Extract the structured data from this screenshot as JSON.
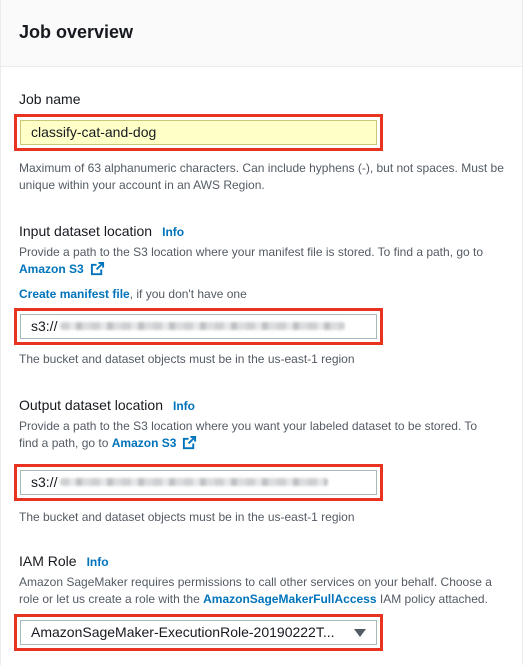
{
  "header": {
    "title": "Job overview"
  },
  "job_name": {
    "label": "Job name",
    "value": "classify-cat-and-dog",
    "hint": "Maximum of 63 alphanumeric characters. Can include hyphens (-), but not spaces. Must be unique within your account in an AWS Region."
  },
  "input_dataset": {
    "label": "Input dataset location",
    "info": "Info",
    "desc_prefix": "Provide a path to the S3 location where your manifest file is stored. To find a path, go to",
    "amazon_s3_link": "Amazon S3",
    "create_manifest_link": "Create manifest file",
    "create_manifest_suffix": ", if you don't have one",
    "value_prefix": "s3://",
    "hint": "The bucket and dataset objects must be in the us-east-1 region"
  },
  "output_dataset": {
    "label": "Output dataset location",
    "info": "Info",
    "desc_line1": "Provide a path to the S3 location where you want your labeled dataset to be stored. To",
    "desc_line2_prefix": "find a path, go to",
    "amazon_s3_link": "Amazon S3",
    "value_prefix": "s3://",
    "hint": "The bucket and dataset objects must be in the us-east-1 region"
  },
  "iam_role": {
    "label": "IAM Role",
    "info": "Info",
    "desc_line1": "Amazon SageMaker requires permissions to call other services on your behalf. Choose a",
    "desc_line2_prefix": "role or let us create a role with the",
    "policy_link": "AmazonSageMakerFullAccess",
    "desc_line2_suffix": "IAM policy attached.",
    "selected_value": "AmazonSageMaker-ExecutionRole-20190222T..."
  },
  "colors": {
    "highlight": "#e7331f",
    "link": "#0073bb",
    "autofill": "#ffffc8"
  },
  "icons": {
    "external_link": "external-link-icon",
    "dropdown": "caret-down-icon"
  }
}
